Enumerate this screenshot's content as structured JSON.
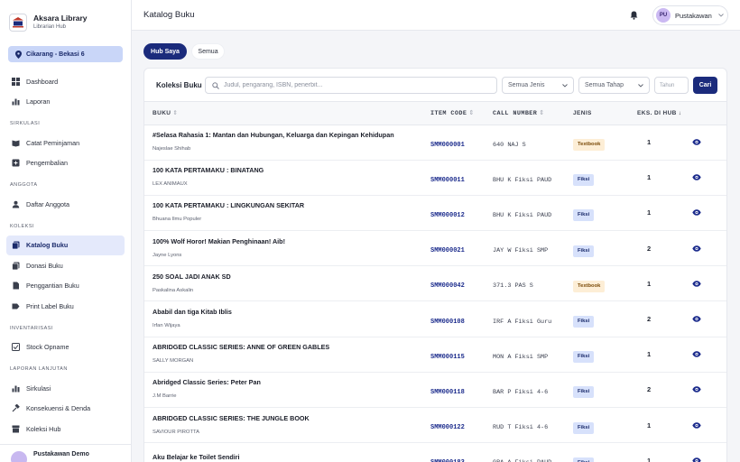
{
  "brand": {
    "name": "Aksara Library",
    "subtitle": "Librarian Hub"
  },
  "branch": "Cikarang - Bekasi 6",
  "nav": [
    {
      "type": "item",
      "label": "Dashboard",
      "icon": "dashboard-icon"
    },
    {
      "type": "item",
      "label": "Laporan",
      "icon": "chart-icon"
    },
    {
      "type": "section",
      "label": "SIRKULASI"
    },
    {
      "type": "item",
      "label": "Catat Peminjaman",
      "icon": "book-open-icon"
    },
    {
      "type": "item",
      "label": "Pengembalian",
      "icon": "return-icon"
    },
    {
      "type": "section",
      "label": "ANGGOTA"
    },
    {
      "type": "item",
      "label": "Daftar Anggota",
      "icon": "users-icon"
    },
    {
      "type": "section",
      "label": "KOLEKSI"
    },
    {
      "type": "item",
      "label": "Katalog Buku",
      "icon": "catalog-icon",
      "active": true
    },
    {
      "type": "item",
      "label": "Donasi Buku",
      "icon": "donation-icon"
    },
    {
      "type": "item",
      "label": "Penggantian Buku",
      "icon": "replace-icon"
    },
    {
      "type": "item",
      "label": "Print Label Buku",
      "icon": "label-icon"
    },
    {
      "type": "section",
      "label": "INVENTARISASI"
    },
    {
      "type": "item",
      "label": "Stock Opname",
      "icon": "stock-icon"
    },
    {
      "type": "section",
      "label": "LAPORAN LANJUTAN"
    },
    {
      "type": "item",
      "label": "Sirkulasi",
      "icon": "chart-icon"
    },
    {
      "type": "item",
      "label": "Konsekuensi & Denda",
      "icon": "gavel-icon"
    },
    {
      "type": "item",
      "label": "Koleksi Hub",
      "icon": "archive-icon"
    }
  ],
  "footer_user": "Pustakawan Demo",
  "header": {
    "title": "Katalog Buku",
    "user_initials": "PU",
    "user_name": "Pustakawan"
  },
  "tabs": {
    "active": "Hub Saya",
    "other": "Semua"
  },
  "card": {
    "title": "Koleksi Buku",
    "search_placeholder": "Judul, pengarang, ISBN, penerbit...",
    "filter_jenis": "Semua Jenis",
    "filter_tahap": "Semua Tahap",
    "year_placeholder": "Tahun",
    "search_button": "Cari"
  },
  "columns": {
    "buku": "BUKU",
    "item_code": "ITEM CODE",
    "call_number": "CALL NUMBER",
    "jenis": "JENIS",
    "eks": "EKS. DI HUB"
  },
  "colors": {
    "accent": "#1b2b7c",
    "active_nav_bg": "#e4e9fb",
    "textbook_badge": "#fdeed6",
    "fiksi_badge": "#d7e1fb"
  },
  "rows": [
    {
      "title": "#Selasa Rahasia 1: Mantan dan Hubungan, Keluarga dan Kepingan Kehidupan",
      "author": "Najeslae Shihab",
      "code": "SMM000001",
      "call": "640 NAJ S",
      "jenis": "Textbook",
      "eks": "1"
    },
    {
      "title": "100 KATA PERTAMAKU : BINATANG",
      "author": "LEX ANIMAUX",
      "code": "SMM000011",
      "call": "BHU K Fiksi PAUD",
      "jenis": "Fiksi",
      "eks": "1"
    },
    {
      "title": "100 KATA PERTAMAKU : LINGKUNGAN SEKITAR",
      "author": "Bhuana Ilmu Populer",
      "code": "SMM000012",
      "call": "BHU K Fiksi PAUD",
      "jenis": "Fiksi",
      "eks": "1"
    },
    {
      "title": "100% Wolf Horor! Makian Penghinaan! Aib!",
      "author": "Jayne Lyons",
      "code": "SMM000021",
      "call": "JAY W Fiksi SMP",
      "jenis": "Fiksi",
      "eks": "2"
    },
    {
      "title": "250 SOAL JADI ANAK SD",
      "author": "Paskalina Askalin",
      "code": "SMM000042",
      "call": "371.3 PAS S",
      "jenis": "Textbook",
      "eks": "1"
    },
    {
      "title": "Ababil dan tiga Kitab Iblis",
      "author": "Irfan Wijaya",
      "code": "SMM000108",
      "call": "IRF A Fiksi Guru",
      "jenis": "Fiksi",
      "eks": "2"
    },
    {
      "title": "ABRIDGED CLASSIC SERIES: ANNE OF GREEN GABLES",
      "author": "SALLY MORGAN",
      "code": "SMM000115",
      "call": "MON A Fiksi SMP",
      "jenis": "Fiksi",
      "eks": "1"
    },
    {
      "title": "Abridged Classic Series: Peter Pan",
      "author": "J.M Barrie",
      "code": "SMM000118",
      "call": "BAR P Fiksi 4-6",
      "jenis": "Fiksi",
      "eks": "2"
    },
    {
      "title": "ABRIDGED CLASSIC SERIES: THE JUNGLE BOOK",
      "author": "SAVIOUR PIROTTA",
      "code": "SMM000122",
      "call": "RUD T Fiksi 4-6",
      "jenis": "Fiksi",
      "eks": "1"
    },
    {
      "title": "Aku Belajar ke Toilet Sendiri",
      "author": "",
      "code": "SMM000183",
      "call": "GRA A Fiksi PAUD",
      "jenis": "Fiksi",
      "eks": "1"
    }
  ]
}
